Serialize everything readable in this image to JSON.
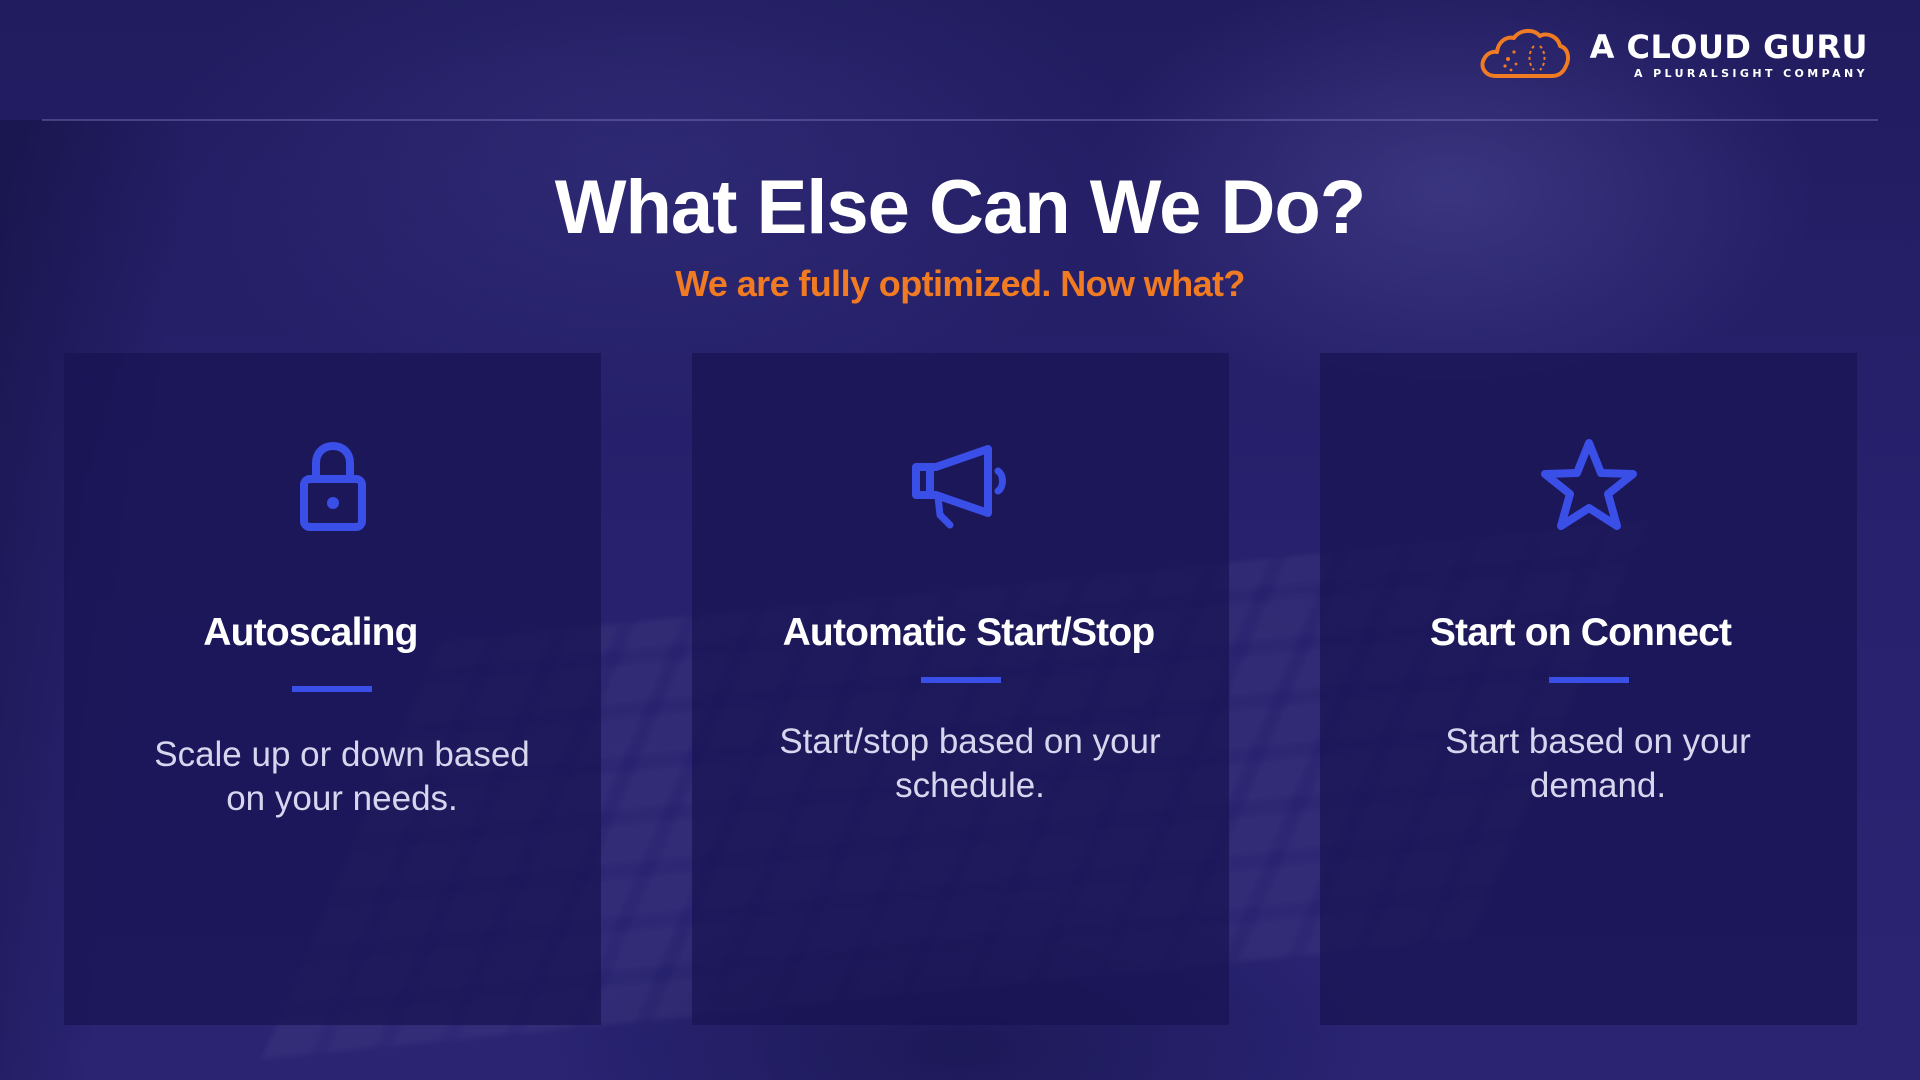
{
  "brand": {
    "name": "A CLOUD GURU",
    "tagline": "A PLURALSIGHT COMPANY",
    "logo_icon": "cloud-logo-icon",
    "accent_color": "#f07b22"
  },
  "slide": {
    "title": "What Else Can We Do?",
    "subtitle": "We are fully optimized. Now what?"
  },
  "cards": [
    {
      "icon": "lock-icon",
      "title": "Autoscaling",
      "description": "Scale up or down based on your needs."
    },
    {
      "icon": "megaphone-icon",
      "title": "Automatic Start/Stop",
      "description": "Start/stop based on your schedule."
    },
    {
      "icon": "star-icon",
      "title": "Start on Connect",
      "description": "Start based on your demand."
    }
  ],
  "colors": {
    "background": "#25206a",
    "card_background": "#181452",
    "icon_blue": "#3a4fe8",
    "subtitle_orange": "#f07b22"
  }
}
